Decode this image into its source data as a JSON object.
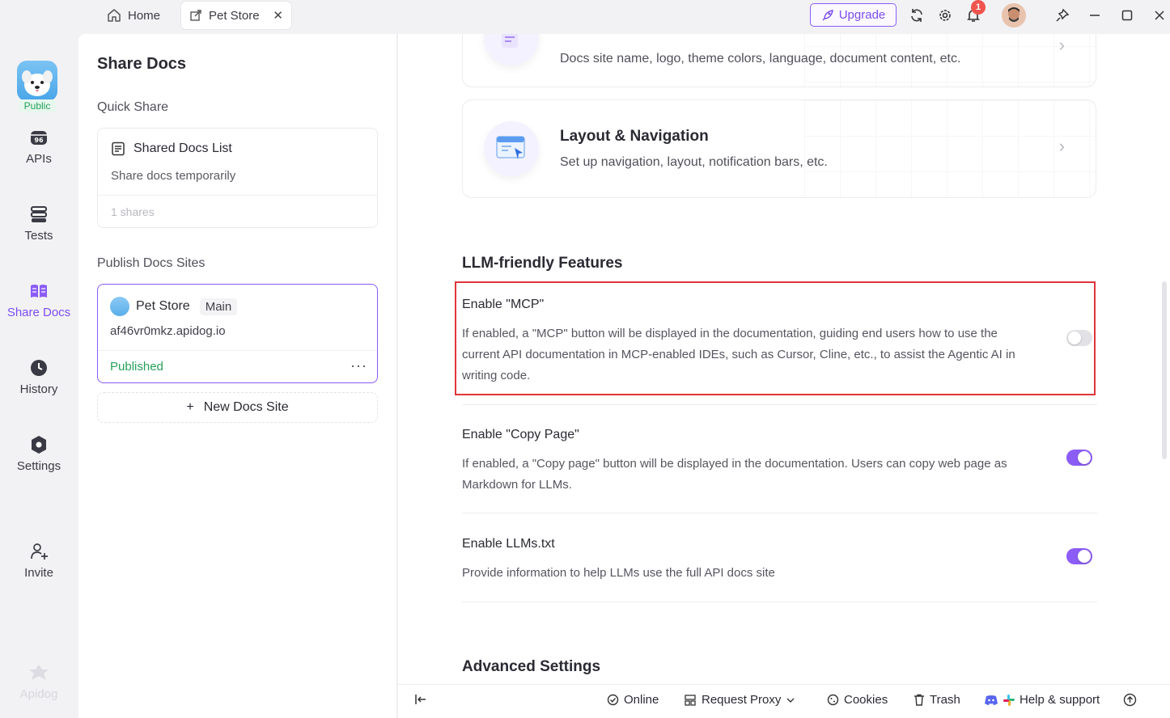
{
  "tabs": {
    "home_label": "Home",
    "pet_label": "Pet Store",
    "close": "✕"
  },
  "topbar": {
    "upgrade_label": "Upgrade",
    "notification_count": "1"
  },
  "rail": {
    "project_tag": "Public",
    "items": [
      {
        "label": "APIs"
      },
      {
        "label": "Tests"
      },
      {
        "label": "Share Docs"
      },
      {
        "label": "History"
      },
      {
        "label": "Settings"
      },
      {
        "label": "Invite"
      }
    ],
    "brand": "Apidog"
  },
  "panel": {
    "title": "Share Docs",
    "quick_share_label": "Quick Share",
    "shared_docs": {
      "title": "Shared Docs List",
      "subtitle": "Share docs temporarily",
      "footer": "1 shares"
    },
    "publish_label": "Publish Docs Sites",
    "site": {
      "name": "Pet Store",
      "branch": "Main",
      "url": "af46vr0mkz.apidog.io",
      "status": "Published",
      "more": "···"
    },
    "new_site_label": "New Docs Site",
    "new_site_plus": "+"
  },
  "main": {
    "card_basic": {
      "desc": "Docs site name, logo, theme colors, language, document content, etc."
    },
    "card_layout": {
      "title": "Layout & Navigation",
      "desc": "Set up navigation, layout, notification bars, etc."
    },
    "llm_heading": "LLM-friendly Features",
    "settings": [
      {
        "title": "Enable \"MCP\"",
        "desc": "If enabled, a \"MCP\" button will be displayed in the documentation, guiding end users how to use the current API documentation in MCP-enabled IDEs, such as Cursor, Cline, etc., to assist the Agentic AI in writing code.",
        "enabled": false
      },
      {
        "title": "Enable \"Copy Page\"",
        "desc": "If enabled, a \"Copy page\" button will be displayed in the documentation. Users can copy web page as Markdown for LLMs.",
        "enabled": true
      },
      {
        "title": "Enable LLMs.txt",
        "desc": "Provide information to help LLMs use the full API docs site",
        "enabled": true
      }
    ],
    "advanced_heading": "Advanced Settings"
  },
  "statusbar": {
    "online": "Online",
    "proxy": "Request Proxy",
    "cookies": "Cookies",
    "trash": "Trash",
    "help": "Help & support"
  },
  "colors": {
    "accent": "#8b5cf6",
    "published": "#26a05b",
    "highlight": "#e0353b"
  }
}
